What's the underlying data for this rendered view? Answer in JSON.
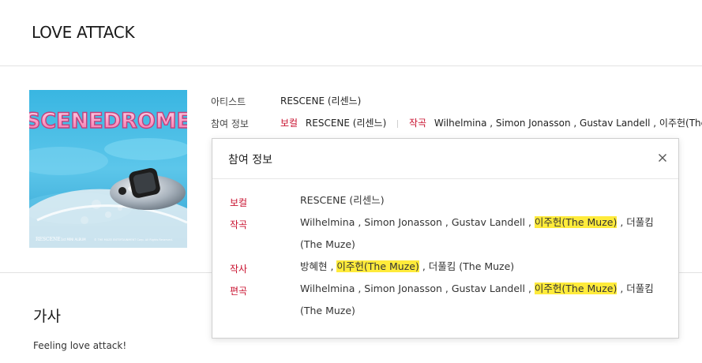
{
  "song_title": "LOVE ATTACK",
  "album_art": {
    "logo_text": "SCENEDROME",
    "footer_artist": "RESCENE",
    "footer_album": "1st MINI ALBUM",
    "footer_copyright": "© THE MUZE ENTERTAINMENT Corp. All Rights Reserved."
  },
  "info": {
    "artist_label": "아티스트",
    "artist_value": "RESCENE (리센느)",
    "participants_label": "참여 정보",
    "vocal_role": "보컬",
    "vocal_value": "RESCENE (리센느)",
    "composer_role": "작곡",
    "composer_value": "Wilhelmina , Simon Jonasson , Gustav Landell , 이주헌(The"
  },
  "popup": {
    "title": "참여 정보",
    "rows": [
      {
        "role": "보컬",
        "pre": "RESCENE (리센느)",
        "highlight": "",
        "post": ""
      },
      {
        "role": "작곡",
        "pre": "Wilhelmina , Simon Jonasson , Gustav Landell , ",
        "highlight": "이주헌(The Muze)",
        "post": " , 더풀킴 (The Muze)"
      },
      {
        "role": "작사",
        "pre": "방혜현 , ",
        "highlight": "이주헌(The Muze)",
        "post": " , 더풀킴 (The Muze)"
      },
      {
        "role": "편곡",
        "pre": "Wilhelmina , Simon Jonasson , Gustav Landell , ",
        "highlight": "이주헌(The Muze)",
        "post": " , 더풀킴 (The Muze)"
      }
    ]
  },
  "lyrics": {
    "heading": "가사",
    "first_line": "Feeling love attack!"
  },
  "colors": {
    "role_red": "#c8102e",
    "highlight": "#ffeb3b",
    "divider": "#e2e2e2"
  },
  "icons": {
    "close": "close-icon"
  }
}
